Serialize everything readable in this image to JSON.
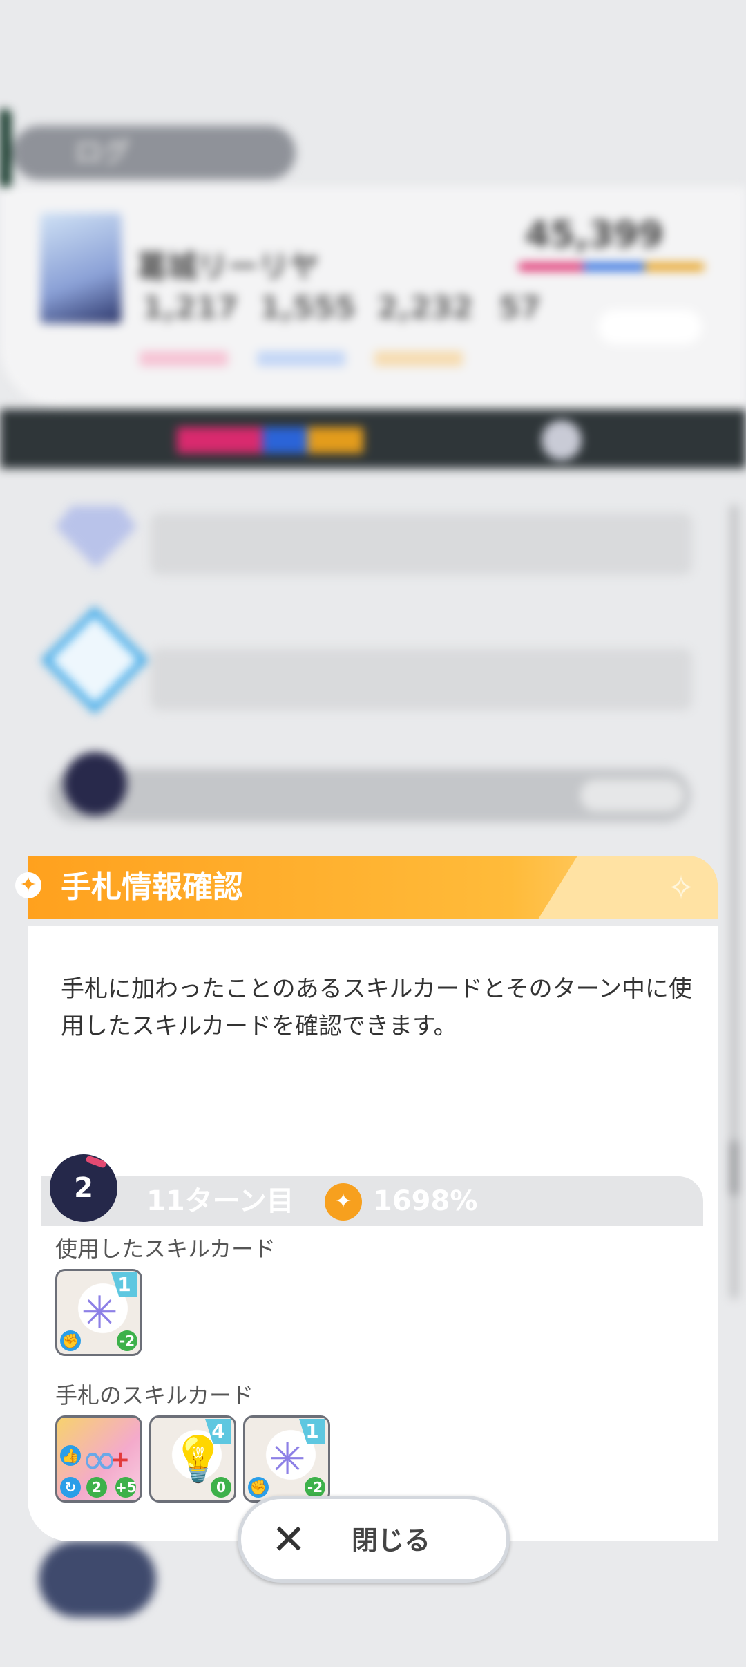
{
  "modal": {
    "title": "手札情報確認",
    "description": "手札に加わったことのあるスキルカードとそのターン中に使用したスキルカードを確認できます。",
    "turn": {
      "stage_number": "2",
      "label": "11ターン目",
      "score": "1698%"
    },
    "used_section_label": "使用したスキルカード",
    "hand_section_label": "手札のスキルカード",
    "used_cards": [
      {
        "cost": "1",
        "stamina": "-2"
      }
    ],
    "hand_cards": [
      {
        "cost": "",
        "badge_a": "2",
        "badge_b": "+5"
      },
      {
        "cost": "4",
        "stamina": "0"
      },
      {
        "cost": "1",
        "stamina": "-2"
      }
    ],
    "close_label": "閉じる"
  },
  "background": {
    "tab_label": "ログ",
    "idol_name": "葛城リーリヤ",
    "score": "45,399",
    "stats": [
      "1,217",
      "1,555",
      "2,232"
    ],
    "stat_extra": "57",
    "turn_label": "11ターン目",
    "turn_score": "1698%"
  },
  "colors": {
    "header_orange": "#ffa11e",
    "dark_turn_circle": "#25284a",
    "card_cost": "#5ec7e0"
  }
}
